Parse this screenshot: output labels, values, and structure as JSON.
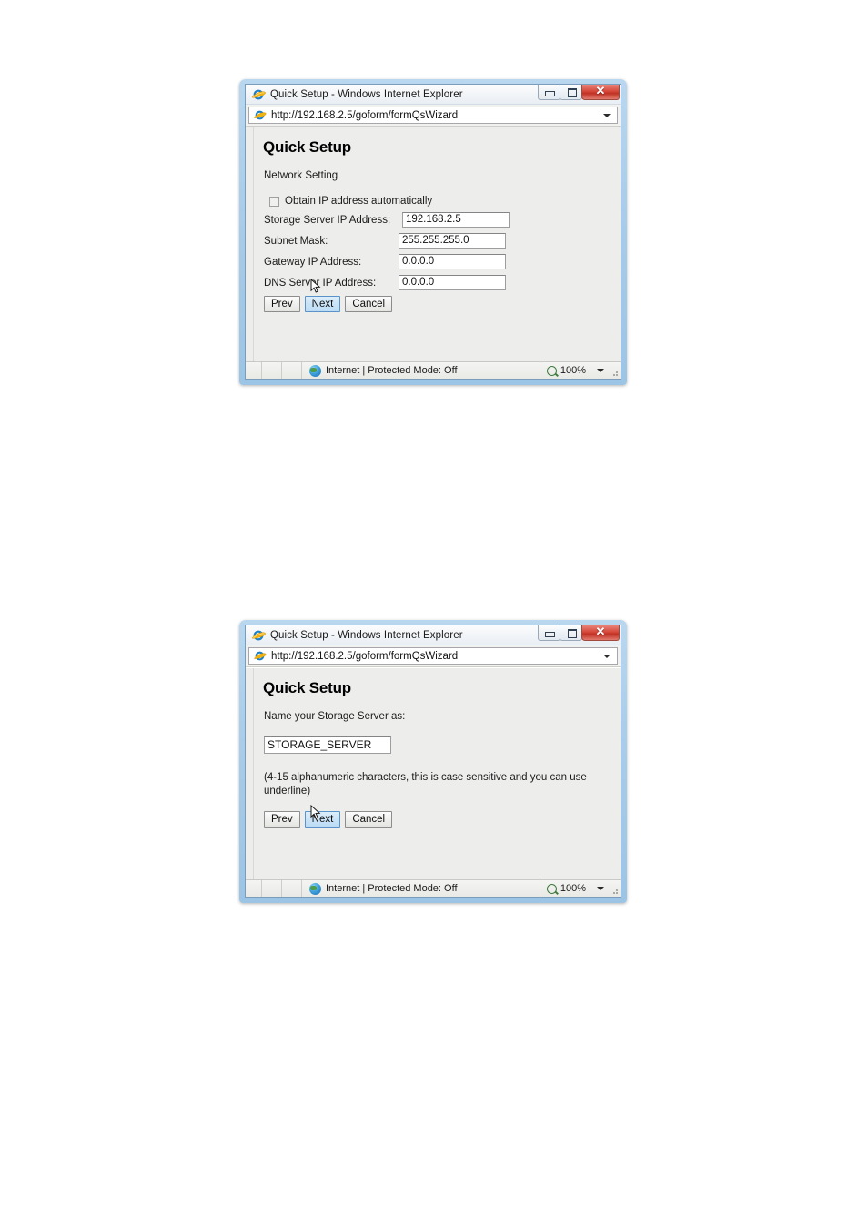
{
  "windows": [
    {
      "id": "window-network-setting",
      "title": "Quick Setup - Windows Internet Explorer",
      "address": "http://192.168.2.5/goform/formQsWizard",
      "icons": {
        "app": "internet-explorer-icon",
        "address": "internet-explorer-icon",
        "minimize": "minimize-icon",
        "maximize": "maximize-icon",
        "close": "close-icon",
        "dropdown": "chevron-down-icon",
        "zone": "globe-icon",
        "zoom": "magnifier-icon"
      },
      "page": {
        "heading": "Quick Setup",
        "section_label": "Network Setting",
        "checkbox": {
          "label": "Obtain IP address automatically",
          "checked": false
        },
        "fields": [
          {
            "label": "Storage Server IP Address:",
            "value": "192.168.2.5"
          },
          {
            "label": "Subnet Mask:",
            "value": "255.255.255.0"
          },
          {
            "label": "Gateway IP Address:",
            "value": "0.0.0.0"
          },
          {
            "label": "DNS Server IP Address:",
            "value": "0.0.0.0"
          }
        ],
        "buttons": [
          {
            "label": "Prev",
            "focused": false
          },
          {
            "label": "Next",
            "focused": true
          },
          {
            "label": "Cancel",
            "focused": false
          }
        ]
      },
      "statusbar": {
        "zone_text": "Internet | Protected Mode: Off",
        "zoom_level": "100%"
      }
    },
    {
      "id": "window-server-name",
      "title": "Quick Setup - Windows Internet Explorer",
      "address": "http://192.168.2.5/goform/formQsWizard",
      "icons": {
        "app": "internet-explorer-icon",
        "address": "internet-explorer-icon",
        "minimize": "minimize-icon",
        "maximize": "maximize-icon",
        "close": "close-icon",
        "dropdown": "chevron-down-icon",
        "zone": "globe-icon",
        "zoom": "magnifier-icon"
      },
      "page": {
        "heading": "Quick Setup",
        "section_label": "Name your Storage Server as:",
        "name_field": {
          "value": "STORAGE_SERVER"
        },
        "hint": "(4-15 alphanumeric characters, this is case sensitive and you can use underline)",
        "buttons": [
          {
            "label": "Prev",
            "focused": false
          },
          {
            "label": "Next",
            "focused": true
          },
          {
            "label": "Cancel",
            "focused": false
          }
        ]
      },
      "statusbar": {
        "zone_text": "Internet | Protected Mode: Off",
        "zoom_level": "100%"
      }
    }
  ],
  "colors": {
    "frame": "#9cc4e4",
    "close_button": "#c03124",
    "focused_button": "#bcdcf4",
    "page_background": "#ededeb"
  }
}
